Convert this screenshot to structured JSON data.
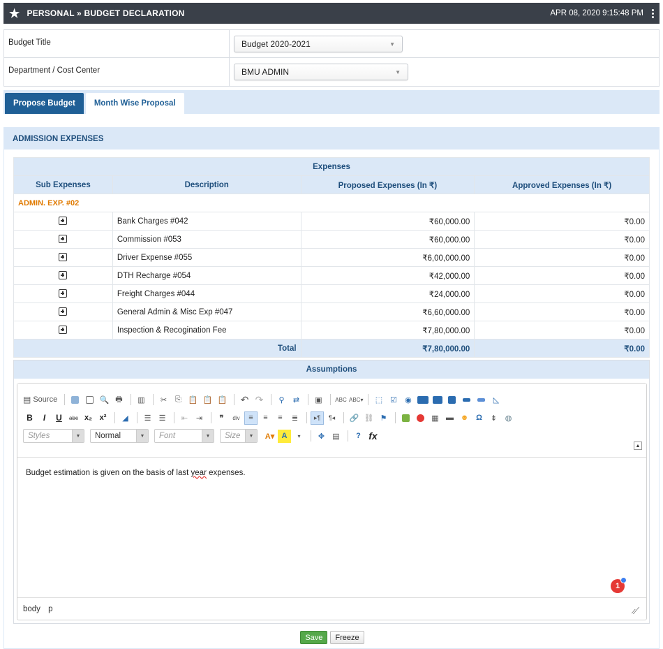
{
  "header": {
    "title": "PERSONAL » BUDGET DECLARATION",
    "datetime": "APR 08, 2020  9:15:48 PM"
  },
  "form": {
    "budget_title_label": "Budget Title",
    "budget_title_value": "Budget 2020-2021",
    "department_label": "Department / Cost Center",
    "department_value": "BMU ADMIN"
  },
  "tabs": [
    {
      "label": "Propose Budget",
      "active": true
    },
    {
      "label": "Month Wise Proposal",
      "active": false
    }
  ],
  "section": {
    "title": "ADMISSION EXPENSES"
  },
  "table": {
    "group_header": "Expenses",
    "columns": [
      "Sub Expenses",
      "Description",
      "Proposed Expenses (In ₹)",
      "Approved Expenses (In ₹)"
    ],
    "group_label": "ADMIN. EXP. #02",
    "rows": [
      {
        "description": "Bank Charges #042",
        "proposed": "₹60,000.00",
        "approved": "₹0.00"
      },
      {
        "description": "Commission #053",
        "proposed": "₹60,000.00",
        "approved": "₹0.00"
      },
      {
        "description": "Driver Expense #055",
        "proposed": "₹6,00,000.00",
        "approved": "₹0.00"
      },
      {
        "description": "DTH Recharge #054",
        "proposed": "₹42,000.00",
        "approved": "₹0.00"
      },
      {
        "description": "Freight Charges #044",
        "proposed": "₹24,000.00",
        "approved": "₹0.00"
      },
      {
        "description": "General Admin & Misc Exp #047",
        "proposed": "₹6,60,000.00",
        "approved": "₹0.00"
      },
      {
        "description": "Inspection & Recogination Fee",
        "proposed": "₹7,80,000.00",
        "approved": "₹0.00"
      }
    ],
    "total_label": "Total",
    "total_proposed": "₹7,80,000.00",
    "total_approved": "₹0.00"
  },
  "assumptions": {
    "title": "Assumptions",
    "source_label": "Source",
    "styles_placeholder": "Styles",
    "format_value": "Normal",
    "font_placeholder": "Font",
    "size_placeholder": "Size",
    "content_before": "Budget estimation is given on the basis of last ",
    "content_word": "year",
    "content_after": " expenses.",
    "badge_count": "1",
    "path": [
      "body",
      "p"
    ]
  },
  "actions": {
    "save_label": "Save",
    "freeze_label": "Freeze"
  },
  "colors": {
    "topbar": "#3a4049",
    "accent": "#1f5f96",
    "header_bg": "#dbe8f7",
    "group_orange": "#e07a00",
    "save_green": "#55a84a"
  }
}
